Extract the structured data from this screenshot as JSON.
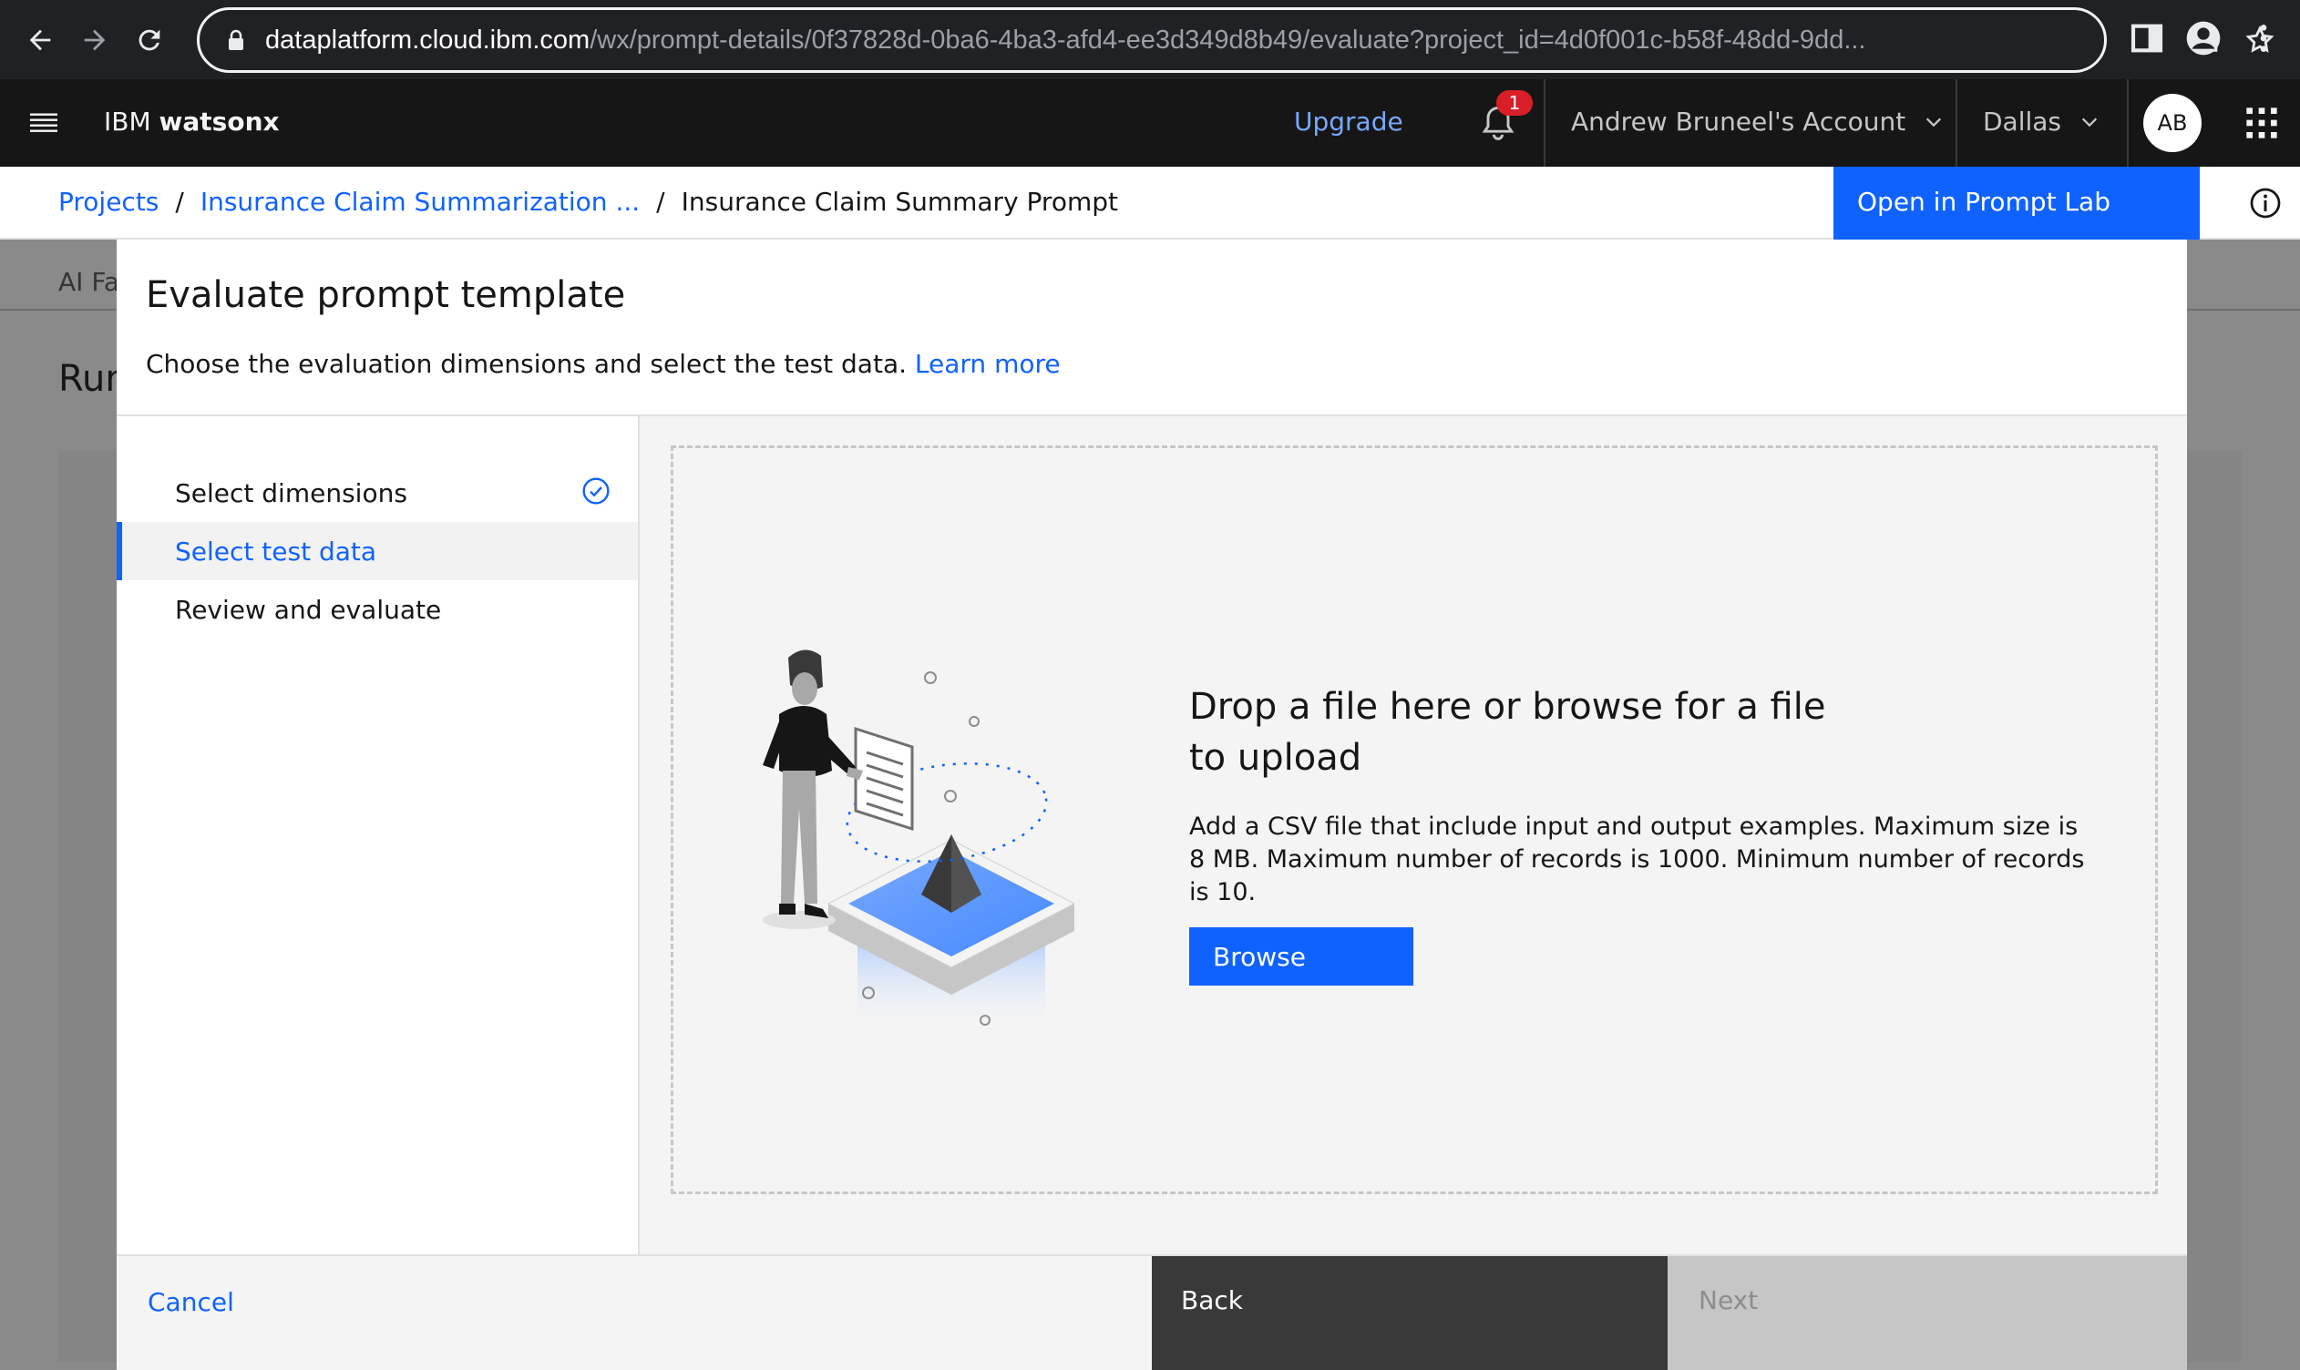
{
  "browser": {
    "url_host": "dataplatform.cloud.ibm.com",
    "url_path": "/wx/prompt-details/0f37828d-0ba6-4ba3-afd4-ee3d349d8b49/evaluate?project_id=4d0f001c-b58f-48dd-9dd..."
  },
  "header": {
    "brand_prefix": "IBM ",
    "brand_name": "watsonx",
    "upgrade_label": "Upgrade",
    "notification_count": "1",
    "account_label": "Andrew Bruneel's Account",
    "region_label": "Dallas",
    "avatar_initials": "AB"
  },
  "breadcrumb": {
    "items": [
      "Projects",
      "Insurance Claim Summarization ...",
      "Insurance Claim Summary Prompt"
    ],
    "separator": "/",
    "open_button": "Open in Prompt Lab"
  },
  "background_page": {
    "tab_partial": "AI Fa",
    "title_partial": "Run"
  },
  "modal": {
    "title": "Evaluate prompt template",
    "subtitle": "Choose the evaluation dimensions and select the test data.",
    "learn_more": "Learn more",
    "steps": [
      {
        "label": "Select dimensions",
        "state": "complete"
      },
      {
        "label": "Select test data",
        "state": "current"
      },
      {
        "label": "Review and evaluate",
        "state": "incomplete"
      }
    ],
    "dropzone": {
      "title": "Drop a file here or browse for a file to upload",
      "description": "Add a CSV file that include input and output examples. Maximum size is 8 MB. Maximum number of records is 1000. Minimum number of records is 10.",
      "browse_label": "Browse"
    },
    "footer": {
      "cancel_label": "Cancel",
      "back_label": "Back",
      "next_label": "Next"
    }
  },
  "colors": {
    "primary": "#0f62fe",
    "header_bg": "#161616",
    "notification": "#da1e28"
  }
}
